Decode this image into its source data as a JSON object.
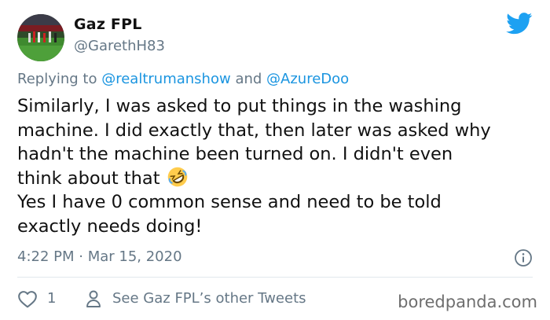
{
  "user": {
    "name": "Gaz FPL",
    "handle": "@GarethH83"
  },
  "reply": {
    "prefix": "Replying to",
    "mention1": "@realtrumanshow",
    "conjunction": "and",
    "mention2": "@AzureDoo"
  },
  "tweet": {
    "lines": [
      "Similarly, I was asked to put things in the washing",
      "machine. I did exactly that, then later was asked why",
      "hadn't the machine been turned on. I didn't even",
      "think about that",
      "Yes I have 0 common sense and need to be told",
      "exactly needs doing!"
    ],
    "emoji": "rolling-on-floor-laughing-emoji"
  },
  "meta": {
    "timestamp": "4:22 PM · Mar 15, 2020"
  },
  "actions": {
    "like_count": "1",
    "see_more": "See Gaz FPL’s other Tweets"
  },
  "watermark": "boredpanda.com",
  "colors": {
    "twitter_blue": "#1da1f2",
    "link": "#1b95e0",
    "secondary_text": "#657786",
    "divider": "#e1e8ed"
  }
}
